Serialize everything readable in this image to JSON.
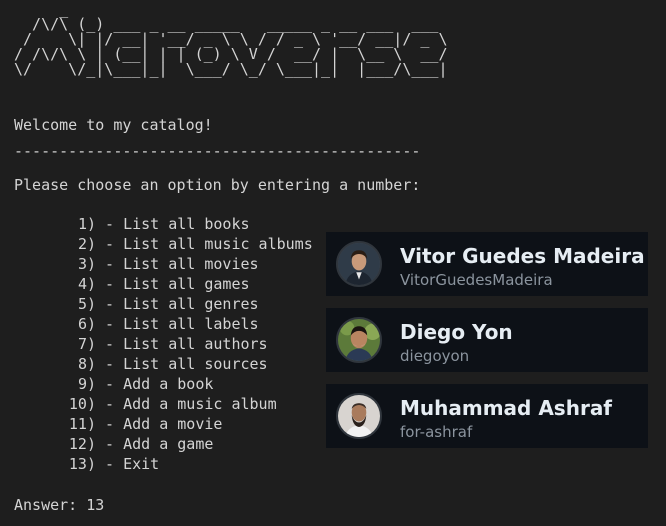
{
  "banner": {
    "ascii_art": "     _\n  /\\/\\ (_) ___ _ __ _____   _____ _ __ ___  ___\n /    \\| |/ __| '__/ _ \\ \\ / / _ \\ '__/ __|/ _ \\\n/ /\\/\\ \\ | (__| | | (_) \\ V /  __/ |  \\__ \\  __/\n\\/    \\/_|\\___|_|  \\___/ \\_/ \\___|_|  |___/\\___|"
  },
  "terminal": {
    "welcome": "Welcome to my catalog!",
    "divider": "---------------------------------------------",
    "prompt": "Please choose an option by entering a number:",
    "answer_label": "Answer:",
    "answer_value": "13"
  },
  "menu": [
    {
      "number": "1)",
      "label": "- List all books"
    },
    {
      "number": "2)",
      "label": "- List all music albums"
    },
    {
      "number": "3)",
      "label": "- List all movies"
    },
    {
      "number": "4)",
      "label": "- List all games"
    },
    {
      "number": "5)",
      "label": "- List all genres"
    },
    {
      "number": "6)",
      "label": "- List all labels"
    },
    {
      "number": "7)",
      "label": "- List all authors"
    },
    {
      "number": "8)",
      "label": "- List all sources"
    },
    {
      "number": "9)",
      "label": "- Add a book"
    },
    {
      "number": "10)",
      "label": "- Add a music album"
    },
    {
      "number": "11)",
      "label": "- Add a movie"
    },
    {
      "number": "12)",
      "label": "- Add a game"
    },
    {
      "number": "13)",
      "label": "- Exit"
    }
  ],
  "contributors": [
    {
      "name": "Vitor Guedes Madeira",
      "login": "VitorGuedesMadeira"
    },
    {
      "name": "Diego Yon",
      "login": "diegoyon"
    },
    {
      "name": "Muhammad Ashraf",
      "login": "for-ashraf"
    }
  ],
  "colors": {
    "background": "#1e1e1e",
    "text": "#d4d4d4",
    "card_background": "#0d1117",
    "card_name": "#e6edf3",
    "card_login": "#8b949e"
  }
}
